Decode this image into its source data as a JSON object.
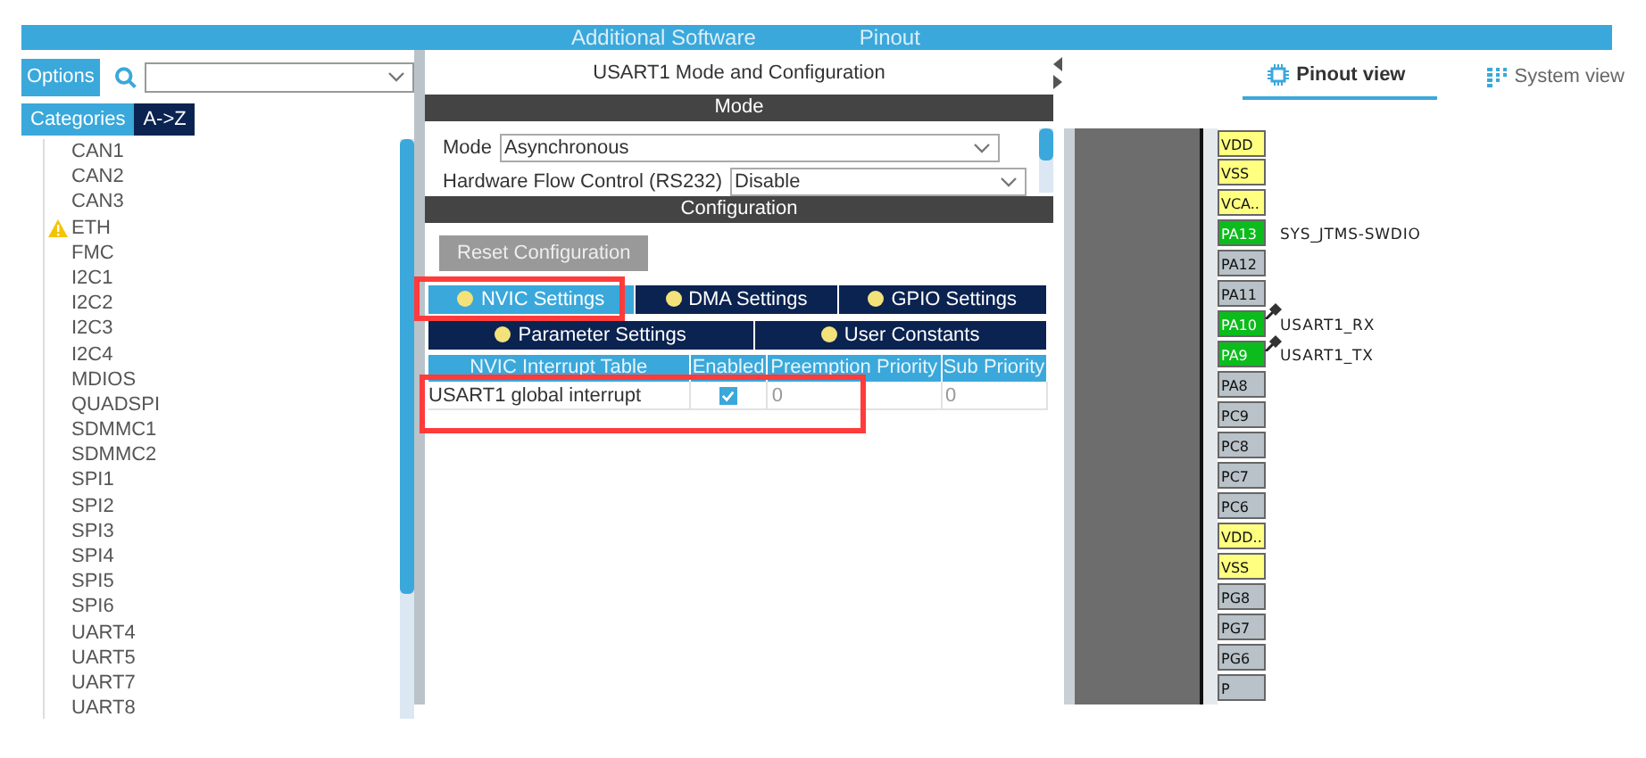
{
  "top_bar": {
    "left_text": "Additional Software",
    "right_text": "Pinout"
  },
  "left_panel": {
    "options_tab": "Options",
    "sort_tabs": [
      {
        "label": "Categories",
        "selected": false
      },
      {
        "label": "A->Z",
        "selected": true
      }
    ],
    "items": [
      {
        "label": "CAN1",
        "warning": false
      },
      {
        "label": "CAN2",
        "warning": false
      },
      {
        "label": "CAN3",
        "warning": false
      },
      {
        "label": "ETH",
        "warning": true
      },
      {
        "label": "FMC",
        "warning": false
      },
      {
        "label": "I2C1",
        "warning": false
      },
      {
        "label": "I2C2",
        "warning": false
      },
      {
        "label": "I2C3",
        "warning": false
      },
      {
        "label": "I2C4",
        "warning": false
      },
      {
        "label": "MDIOS",
        "warning": false
      },
      {
        "label": "QUADSPI",
        "warning": false
      },
      {
        "label": "SDMMC1",
        "warning": false
      },
      {
        "label": "SDMMC2",
        "warning": false
      },
      {
        "label": "SPI1",
        "warning": false
      },
      {
        "label": "SPI2",
        "warning": false
      },
      {
        "label": "SPI3",
        "warning": false
      },
      {
        "label": "SPI4",
        "warning": false
      },
      {
        "label": "SPI5",
        "warning": false
      },
      {
        "label": "SPI6",
        "warning": false
      },
      {
        "label": "UART4",
        "warning": false
      },
      {
        "label": "UART5",
        "warning": false
      },
      {
        "label": "UART7",
        "warning": false
      },
      {
        "label": "UART8",
        "warning": false
      }
    ]
  },
  "config_panel": {
    "title": "USART1 Mode and Configuration",
    "mode_header": "Mode",
    "fields": [
      {
        "label": "Mode",
        "value": "Asynchronous"
      },
      {
        "label": "Hardware Flow Control (RS232)",
        "value": "Disable"
      }
    ],
    "configuration_header": "Configuration",
    "reset_button": "Reset Configuration",
    "tab_rows": [
      [
        {
          "label": "NVIC Settings",
          "selected": true,
          "highlighted": true
        },
        {
          "label": "DMA Settings",
          "selected": false,
          "highlighted": false
        },
        {
          "label": "GPIO Settings",
          "selected": false,
          "highlighted": false
        }
      ],
      [
        {
          "label": "Parameter Settings",
          "selected": false,
          "highlighted": false
        },
        {
          "label": "User Constants",
          "selected": false,
          "highlighted": false
        }
      ]
    ],
    "table": {
      "columns": [
        "NVIC Interrupt Table",
        "Enabled",
        "Preemption Priority",
        "Sub Priority"
      ],
      "rows": [
        {
          "name": "USART1 global interrupt",
          "enabled": true,
          "preemption": "0",
          "sub": "0",
          "highlighted": true
        }
      ]
    }
  },
  "pinout": {
    "view_tabs": [
      {
        "label": "Pinout view",
        "selected": true
      },
      {
        "label": "System view",
        "selected": false
      }
    ],
    "pins": [
      {
        "name": "VDD",
        "kind": "power"
      },
      {
        "name": "VSS",
        "kind": "power"
      },
      {
        "name": "VCA..",
        "kind": "power"
      },
      {
        "name": "PA13",
        "kind": "assigned",
        "signal": "SYS_JTMS-SWDIO",
        "pinned": false
      },
      {
        "name": "PA12",
        "kind": "free"
      },
      {
        "name": "PA11",
        "kind": "free"
      },
      {
        "name": "PA10",
        "kind": "assigned",
        "signal": "USART1_RX",
        "pinned": true
      },
      {
        "name": "PA9",
        "kind": "assigned",
        "signal": "USART1_TX",
        "pinned": true
      },
      {
        "name": "PA8",
        "kind": "free"
      },
      {
        "name": "PC9",
        "kind": "free"
      },
      {
        "name": "PC8",
        "kind": "free"
      },
      {
        "name": "PC7",
        "kind": "free"
      },
      {
        "name": "PC6",
        "kind": "free"
      },
      {
        "name": "VDD..",
        "kind": "power"
      },
      {
        "name": "VSS",
        "kind": "power"
      },
      {
        "name": "PG8",
        "kind": "free"
      },
      {
        "name": "PG7",
        "kind": "free"
      },
      {
        "name": "PG6",
        "kind": "free"
      },
      {
        "name": "P",
        "kind": "free"
      }
    ]
  }
}
